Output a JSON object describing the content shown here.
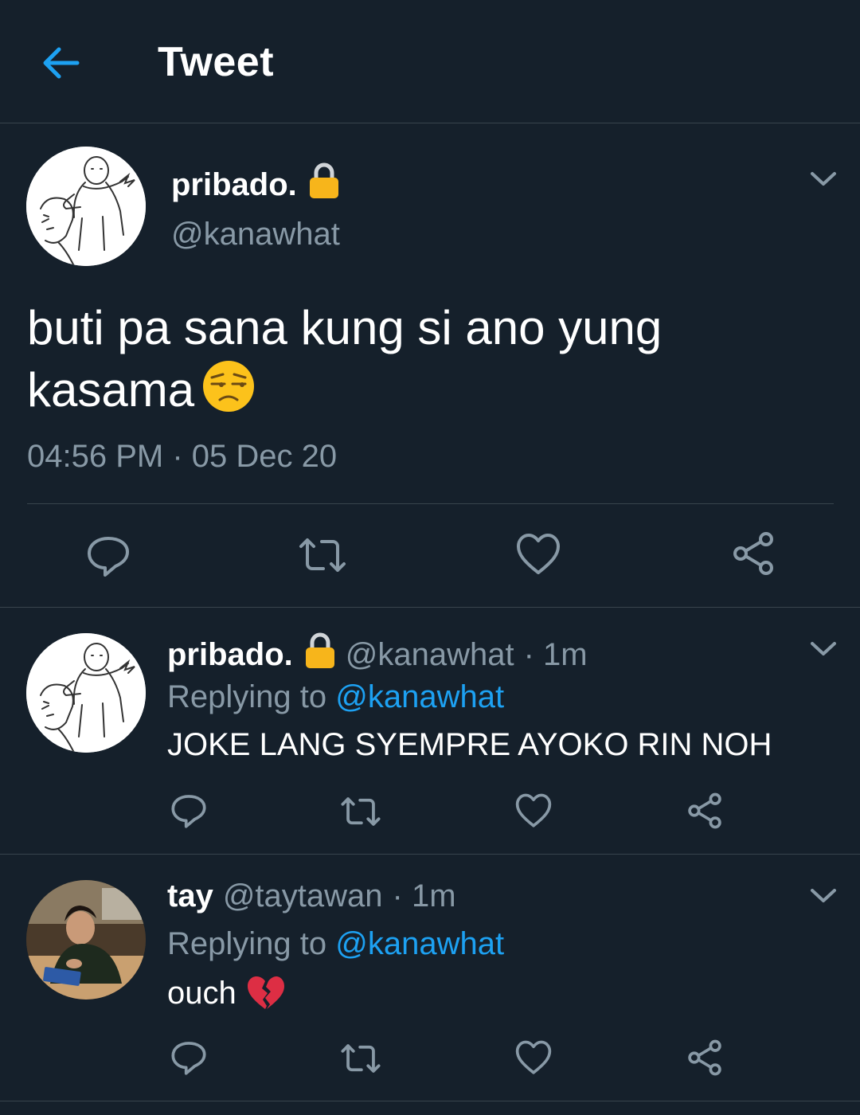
{
  "header": {
    "title": "Tweet",
    "back_icon": "arrow-left-icon",
    "accent": "#1da1f2"
  },
  "main_tweet": {
    "name": "pribado.",
    "handle": "@kanawhat",
    "text": "buti pa sana kung si ano yung kasama",
    "emoji": "😒",
    "timestamp": "04:56 PM · 05 Dec 20",
    "actions": [
      "reply-icon",
      "retweet-icon",
      "like-icon",
      "share-icon"
    ]
  },
  "replies": [
    {
      "name": "pribado.",
      "handle": "@kanawhat",
      "time": "· 1m",
      "replying_label": "Replying to",
      "replying_to": "@kanawhat",
      "text": "JOKE LANG SYEMPRE AYOKO RIN NOH"
    },
    {
      "name": "tay",
      "handle": "@taytawan",
      "time": "· 1m",
      "replying_label": "Replying to",
      "replying_to": "@kanawhat",
      "text": "ouch",
      "emoji": "💔"
    }
  ],
  "colors": {
    "background": "#15202b",
    "secondary_text": "#8899a6",
    "divider": "#38444d",
    "link": "#1da1f2"
  }
}
